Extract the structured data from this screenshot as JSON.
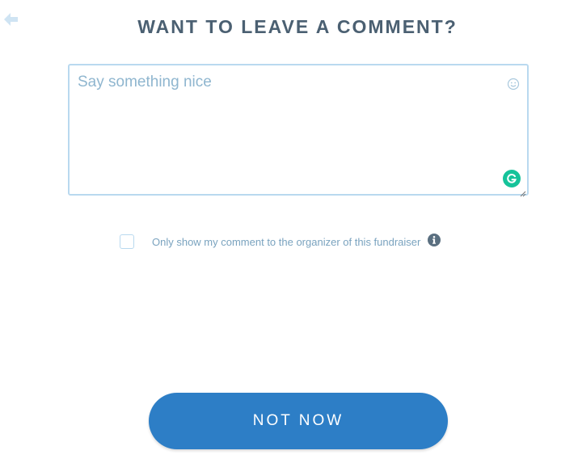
{
  "header": {
    "back_icon": "arrow-left-icon",
    "title": "WANT TO LEAVE A COMMENT?"
  },
  "comment": {
    "value": "",
    "placeholder": "Say something nice",
    "emoji_icon": "smiley-icon",
    "grammarly_icon": "grammarly-icon"
  },
  "privacy": {
    "checked": false,
    "label": "Only show my comment to the organizer of this fundraiser",
    "info_icon": "info-icon"
  },
  "actions": {
    "not_now_label": "NOT NOW"
  },
  "colors": {
    "title": "#4b6072",
    "accent": "#2d7ec6",
    "border": "#b9d9ef",
    "placeholder": "#8fb6cf",
    "grammarly": "#15c39a"
  }
}
